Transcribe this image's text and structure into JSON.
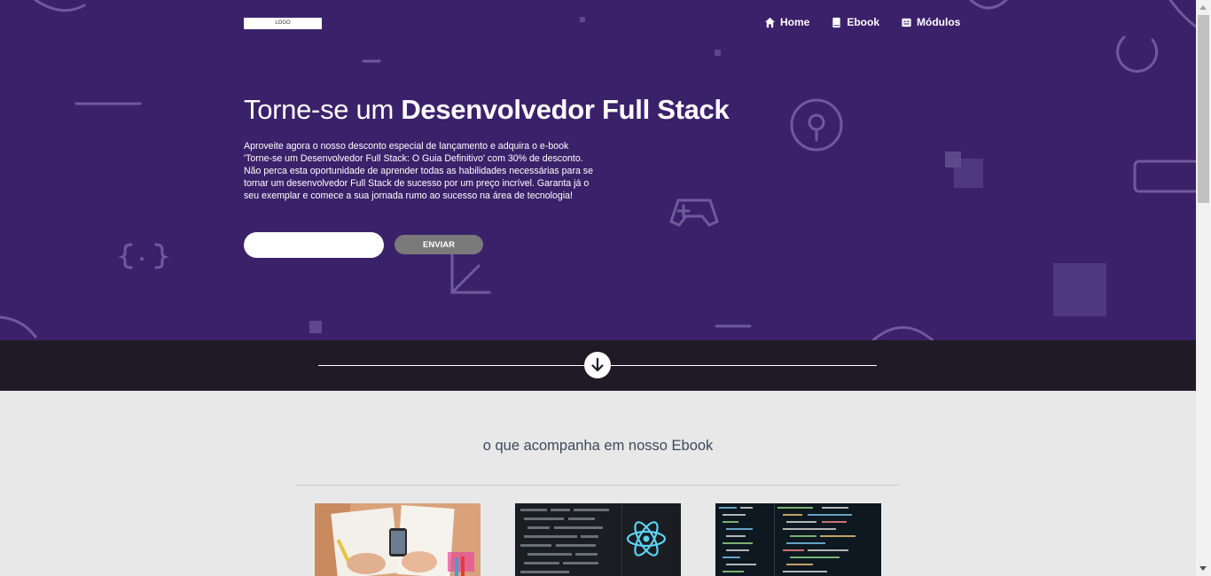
{
  "header": {
    "logo_text": "LOGO",
    "nav": [
      {
        "label": "Home",
        "icon": "home-icon"
      },
      {
        "label": "Ebook",
        "icon": "book-icon"
      },
      {
        "label": "Módulos",
        "icon": "modules-icon"
      }
    ]
  },
  "hero": {
    "title_light": "Torne-se um ",
    "title_bold": "Desenvolvedor Full Stack",
    "description": "Aproveite agora o nosso desconto especial de lançamento e adquira o e-book 'Torne-se um Desenvolvedor Full Stack: O Guia Definitivo' com 30% de desconto. Não perca esta oportunidade de aprender todas as habilidades necessárias para se tornar um desenvolvedor Full Stack de sucesso por um preço incrível. Garanta já o seu exemplar e comece a sua jornada rumo ao sucesso na área de tecnologia!",
    "email_value": "",
    "email_placeholder": "",
    "submit_label": "ENVIAR"
  },
  "divider": {
    "icon": "arrow-down-icon"
  },
  "features": {
    "title": "o que acompanha em nosso Ebook",
    "cards": [
      {
        "image": "desk-workspace-photo"
      },
      {
        "image": "react-code-photo"
      },
      {
        "image": "code-editor-photo"
      }
    ]
  },
  "colors": {
    "hero_bg": "#3b216a",
    "band_bg": "#1f1b26",
    "page_bg": "#e8e8e8",
    "button_bg": "#7a7a7a",
    "section_title": "#3c4a5c"
  }
}
